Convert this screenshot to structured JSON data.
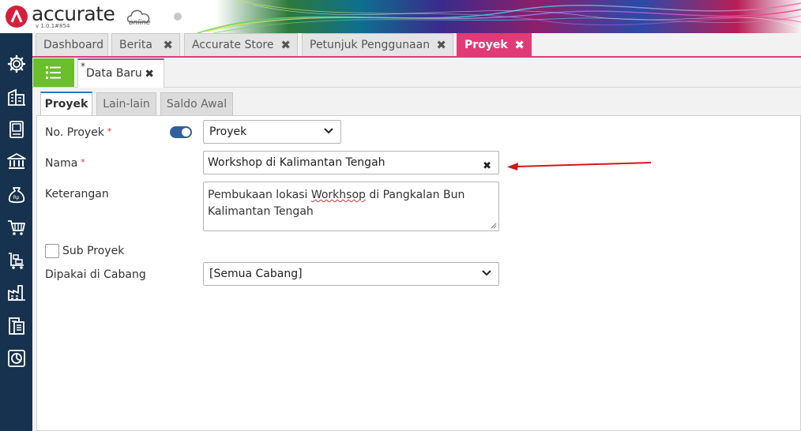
{
  "app": {
    "logo_text": "accurate",
    "logo_suffix": "online",
    "version": "v 1.0.1#854"
  },
  "sidebar": {
    "items": [
      {
        "icon": "gear-icon"
      },
      {
        "icon": "buildings-icon"
      },
      {
        "icon": "book-icon"
      },
      {
        "icon": "bank-icon"
      },
      {
        "icon": "money-bag-icon"
      },
      {
        "icon": "cart-icon"
      },
      {
        "icon": "delivery-cart-icon"
      },
      {
        "icon": "factory-icon"
      },
      {
        "icon": "tax-document-icon"
      },
      {
        "icon": "report-chart-icon"
      }
    ]
  },
  "tabs": [
    {
      "label": "Dashboard",
      "closable": false
    },
    {
      "label": "Berita",
      "closable": true
    },
    {
      "label": "Accurate Store",
      "closable": true
    },
    {
      "label": "Petunjuk Penggunaan",
      "closable": true
    },
    {
      "label": "Proyek",
      "closable": true,
      "active": true
    }
  ],
  "subtab": {
    "marker": "*",
    "label": "Data Baru"
  },
  "form_tabs": [
    {
      "label": "Proyek",
      "active": true
    },
    {
      "label": "Lain-lain"
    },
    {
      "label": "Saldo Awal"
    }
  ],
  "form": {
    "no_proyek": {
      "label": "No. Proyek",
      "required_mark": "*",
      "toggle_on": true,
      "selected": "Proyek"
    },
    "nama": {
      "label": "Nama",
      "required_mark": "*",
      "value": "Workshop di Kalimantan Tengah"
    },
    "keterangan": {
      "label": "Keterangan",
      "line1_before": "Pembukaan lokasi ",
      "line1_typo": "Workhsop",
      "line1_after": " di Pangkalan Bun",
      "line2": "Kalimantan Tengah"
    },
    "sub_proyek": {
      "label": "Sub Proyek",
      "checked": false
    },
    "cabang": {
      "label": "Dipakai di Cabang",
      "selected": "[Semua Cabang]"
    }
  },
  "colors": {
    "accent_pink": "#e13b77",
    "sidebar": "#17324e",
    "list_button": "#6abf2a",
    "annotation_arrow": "#d9141b"
  }
}
